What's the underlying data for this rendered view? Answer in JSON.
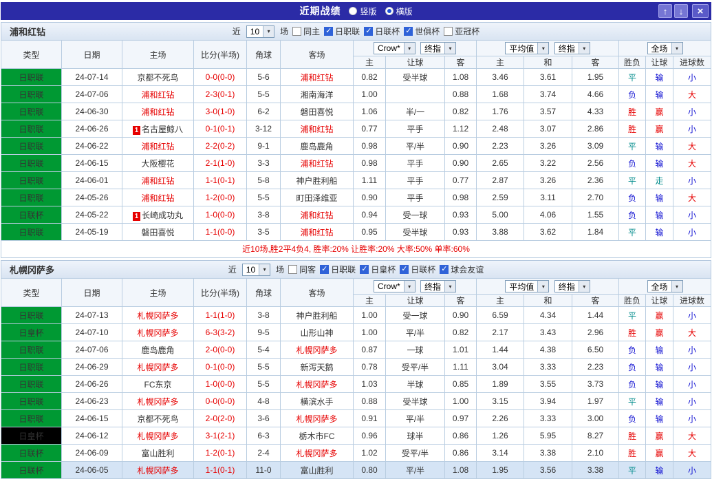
{
  "titlebar": {
    "title": "近期战绩",
    "options": [
      {
        "label": "竖版",
        "selected": false
      },
      {
        "label": "横版",
        "selected": true
      }
    ],
    "up_icon": "↑",
    "down_icon": "↓",
    "close_icon": "×"
  },
  "colors": {
    "accent_bar": "#2b2ba6",
    "league_green": "#009933",
    "league_black": "#000000",
    "focus_team": "#e60000",
    "score": "#e60000",
    "win": "#e60000",
    "draw": "#008b8b",
    "lose": "#1414d2",
    "cover": "#e60000",
    "not_cover": "#1414d2",
    "push": "#008b8b",
    "over": "#e60000",
    "under": "#1414d2",
    "row_highlight": "#d5e4f5"
  },
  "maps": {
    "result": {
      "胜": "win",
      "平": "draw",
      "负": "lose"
    },
    "handicap": {
      "赢": "cover",
      "输": "not_cover",
      "走": "push"
    },
    "goals": {
      "大": "over",
      "小": "under"
    }
  },
  "sections": [
    {
      "team": "浦和红钻",
      "filter": {
        "near": "近",
        "count": "10",
        "unit": "场",
        "checkboxes": [
          {
            "label": "同主",
            "checked": false
          },
          {
            "label": "日职联",
            "checked": true
          },
          {
            "label": "日联杯",
            "checked": true
          },
          {
            "label": "世俱杯",
            "checked": true
          },
          {
            "label": "亚冠杯",
            "checked": false
          }
        ]
      },
      "header": {
        "cols": [
          "类型",
          "日期",
          "主场",
          "比分(半场)",
          "角球",
          "客场"
        ],
        "bookmaker": "Crow*",
        "stage1": "终指",
        "avg": "平均值",
        "stage2": "终指",
        "fulltime": "全场",
        "sub": [
          "主",
          "让球",
          "客",
          "主",
          "和",
          "客",
          "胜负",
          "让球",
          "进球数"
        ]
      },
      "rows": [
        {
          "league": "日职联",
          "league_color": "league_green",
          "date": "24-07-14",
          "home": "京都不死鸟",
          "home_focus": false,
          "home_badge": "",
          "score": "0-0(0-0)",
          "corner": "5-6",
          "away": "浦和红钻",
          "away_focus": true,
          "odds": [
            "0.82",
            "受半球",
            "1.08"
          ],
          "avg": [
            "3.46",
            "3.61",
            "1.95"
          ],
          "result": "平",
          "handicap": "输",
          "goals": "小"
        },
        {
          "league": "日职联",
          "league_color": "league_green",
          "date": "24-07-06",
          "home": "浦和红钻",
          "home_focus": true,
          "home_badge": "",
          "score": "2-3(0-1)",
          "corner": "5-5",
          "away": "湘南海洋",
          "away_focus": false,
          "odds": [
            "1.00",
            "",
            "0.88"
          ],
          "avg": [
            "1.68",
            "3.74",
            "4.66"
          ],
          "result": "负",
          "handicap": "输",
          "goals": "大"
        },
        {
          "league": "日职联",
          "league_color": "league_green",
          "date": "24-06-30",
          "home": "浦和红钻",
          "home_focus": true,
          "home_badge": "",
          "score": "3-0(1-0)",
          "corner": "6-2",
          "away": "磐田喜悦",
          "away_focus": false,
          "odds": [
            "1.06",
            "半/一",
            "0.82"
          ],
          "avg": [
            "1.76",
            "3.57",
            "4.33"
          ],
          "result": "胜",
          "handicap": "赢",
          "goals": "小"
        },
        {
          "league": "日职联",
          "league_color": "league_green",
          "date": "24-06-26",
          "home": "名古屋鲸八",
          "home_focus": false,
          "home_badge": "1",
          "score": "0-1(0-1)",
          "corner": "3-12",
          "away": "浦和红钻",
          "away_focus": true,
          "odds": [
            "0.77",
            "平手",
            "1.12"
          ],
          "avg": [
            "2.48",
            "3.07",
            "2.86"
          ],
          "result": "胜",
          "handicap": "赢",
          "goals": "小"
        },
        {
          "league": "日职联",
          "league_color": "league_green",
          "date": "24-06-22",
          "home": "浦和红钻",
          "home_focus": true,
          "home_badge": "",
          "score": "2-2(0-2)",
          "corner": "9-1",
          "away": "鹿岛鹿角",
          "away_focus": false,
          "odds": [
            "0.98",
            "平/半",
            "0.90"
          ],
          "avg": [
            "2.23",
            "3.26",
            "3.09"
          ],
          "result": "平",
          "handicap": "输",
          "goals": "大"
        },
        {
          "league": "日职联",
          "league_color": "league_green",
          "date": "24-06-15",
          "home": "大阪樱花",
          "home_focus": false,
          "home_badge": "",
          "score": "2-1(1-0)",
          "corner": "3-3",
          "away": "浦和红钻",
          "away_focus": true,
          "odds": [
            "0.98",
            "平手",
            "0.90"
          ],
          "avg": [
            "2.65",
            "3.22",
            "2.56"
          ],
          "result": "负",
          "handicap": "输",
          "goals": "大"
        },
        {
          "league": "日职联",
          "league_color": "league_green",
          "date": "24-06-01",
          "home": "浦和红钻",
          "home_focus": true,
          "home_badge": "",
          "score": "1-1(0-1)",
          "corner": "5-8",
          "away": "神户胜利船",
          "away_focus": false,
          "odds": [
            "1.11",
            "平手",
            "0.77"
          ],
          "avg": [
            "2.87",
            "3.26",
            "2.36"
          ],
          "result": "平",
          "handicap": "走",
          "goals": "小"
        },
        {
          "league": "日职联",
          "league_color": "league_green",
          "date": "24-05-26",
          "home": "浦和红钻",
          "home_focus": true,
          "home_badge": "",
          "score": "1-2(0-0)",
          "corner": "5-5",
          "away": "町田泽维亚",
          "away_focus": false,
          "odds": [
            "0.90",
            "平手",
            "0.98"
          ],
          "avg": [
            "2.59",
            "3.11",
            "2.70"
          ],
          "result": "负",
          "handicap": "输",
          "goals": "大"
        },
        {
          "league": "日联杯",
          "league_color": "league_green",
          "date": "24-05-22",
          "home": "长崎成功丸",
          "home_focus": false,
          "home_badge": "1",
          "score": "1-0(0-0)",
          "corner": "3-8",
          "away": "浦和红钻",
          "away_focus": true,
          "odds": [
            "0.94",
            "受一球",
            "0.93"
          ],
          "avg": [
            "5.00",
            "4.06",
            "1.55"
          ],
          "result": "负",
          "handicap": "输",
          "goals": "小"
        },
        {
          "league": "日职联",
          "league_color": "league_green",
          "date": "24-05-19",
          "home": "磐田喜悦",
          "home_focus": false,
          "home_badge": "",
          "score": "1-1(0-0)",
          "corner": "3-5",
          "away": "浦和红钻",
          "away_focus": true,
          "odds": [
            "0.95",
            "受半球",
            "0.93"
          ],
          "avg": [
            "3.88",
            "3.62",
            "1.84"
          ],
          "result": "平",
          "handicap": "输",
          "goals": "小"
        }
      ],
      "summary": "近10场,胜2平4负4, 胜率:20% 让胜率:20% 大率:50% 单率:60%"
    },
    {
      "team": "札幌冈萨多",
      "filter": {
        "near": "近",
        "count": "10",
        "unit": "场",
        "checkboxes": [
          {
            "label": "同客",
            "checked": false
          },
          {
            "label": "日职联",
            "checked": true
          },
          {
            "label": "日皇杯",
            "checked": true
          },
          {
            "label": "日联杯",
            "checked": true
          },
          {
            "label": "球会友谊",
            "checked": true
          }
        ]
      },
      "header": {
        "cols": [
          "类型",
          "日期",
          "主场",
          "比分(半场)",
          "角球",
          "客场"
        ],
        "bookmaker": "Crow*",
        "stage1": "终指",
        "avg": "平均值",
        "stage2": "终指",
        "fulltime": "全场",
        "sub": [
          "主",
          "让球",
          "客",
          "主",
          "和",
          "客",
          "胜负",
          "让球",
          "进球数"
        ]
      },
      "rows": [
        {
          "league": "日职联",
          "league_color": "league_green",
          "date": "24-07-13",
          "home": "札幌冈萨多",
          "home_focus": true,
          "home_badge": "",
          "score": "1-1(1-0)",
          "corner": "3-8",
          "away": "神户胜利船",
          "away_focus": false,
          "odds": [
            "1.00",
            "受一球",
            "0.90"
          ],
          "avg": [
            "6.59",
            "4.34",
            "1.44"
          ],
          "result": "平",
          "handicap": "赢",
          "goals": "小"
        },
        {
          "league": "日皇杯",
          "league_color": "league_green",
          "date": "24-07-10",
          "home": "札幌冈萨多",
          "home_focus": true,
          "home_badge": "",
          "score": "6-3(3-2)",
          "corner": "9-5",
          "away": "山形山神",
          "away_focus": false,
          "odds": [
            "1.00",
            "平/半",
            "0.82"
          ],
          "avg": [
            "2.17",
            "3.43",
            "2.96"
          ],
          "result": "胜",
          "handicap": "赢",
          "goals": "大"
        },
        {
          "league": "日职联",
          "league_color": "league_green",
          "date": "24-07-06",
          "home": "鹿岛鹿角",
          "home_focus": false,
          "home_badge": "",
          "score": "2-0(0-0)",
          "corner": "5-4",
          "away": "札幌冈萨多",
          "away_focus": true,
          "odds": [
            "0.87",
            "一球",
            "1.01"
          ],
          "avg": [
            "1.44",
            "4.38",
            "6.50"
          ],
          "result": "负",
          "handicap": "输",
          "goals": "小"
        },
        {
          "league": "日职联",
          "league_color": "league_green",
          "date": "24-06-29",
          "home": "札幌冈萨多",
          "home_focus": true,
          "home_badge": "",
          "score": "0-1(0-0)",
          "corner": "5-5",
          "away": "新泻天鹅",
          "away_focus": false,
          "odds": [
            "0.78",
            "受平/半",
            "1.11"
          ],
          "avg": [
            "3.04",
            "3.33",
            "2.23"
          ],
          "result": "负",
          "handicap": "输",
          "goals": "小"
        },
        {
          "league": "日职联",
          "league_color": "league_green",
          "date": "24-06-26",
          "home": "FC东京",
          "home_focus": false,
          "home_badge": "",
          "score": "1-0(0-0)",
          "corner": "5-5",
          "away": "札幌冈萨多",
          "away_focus": true,
          "odds": [
            "1.03",
            "半球",
            "0.85"
          ],
          "avg": [
            "1.89",
            "3.55",
            "3.73"
          ],
          "result": "负",
          "handicap": "输",
          "goals": "小"
        },
        {
          "league": "日职联",
          "league_color": "league_green",
          "date": "24-06-23",
          "home": "札幌冈萨多",
          "home_focus": true,
          "home_badge": "",
          "score": "0-0(0-0)",
          "corner": "4-8",
          "away": "横滨水手",
          "away_focus": false,
          "odds": [
            "0.88",
            "受半球",
            "1.00"
          ],
          "avg": [
            "3.15",
            "3.94",
            "1.97"
          ],
          "result": "平",
          "handicap": "输",
          "goals": "小"
        },
        {
          "league": "日职联",
          "league_color": "league_green",
          "date": "24-06-15",
          "home": "京都不死鸟",
          "home_focus": false,
          "home_badge": "",
          "score": "2-0(2-0)",
          "corner": "3-6",
          "away": "札幌冈萨多",
          "away_focus": true,
          "odds": [
            "0.91",
            "平/半",
            "0.97"
          ],
          "avg": [
            "2.26",
            "3.33",
            "3.00"
          ],
          "result": "负",
          "handicap": "输",
          "goals": "小"
        },
        {
          "league": "日皇杯",
          "league_color": "league_black",
          "date": "24-06-12",
          "home": "札幌冈萨多",
          "home_focus": true,
          "home_badge": "",
          "score": "3-1(2-1)",
          "corner": "6-3",
          "away": "栃木市FC",
          "away_focus": false,
          "odds": [
            "0.96",
            "球半",
            "0.86"
          ],
          "avg": [
            "1.26",
            "5.95",
            "8.27"
          ],
          "result": "胜",
          "handicap": "赢",
          "goals": "大"
        },
        {
          "league": "日联杯",
          "league_color": "league_green",
          "date": "24-06-09",
          "home": "富山胜利",
          "home_focus": false,
          "home_badge": "",
          "score": "1-2(0-1)",
          "corner": "2-4",
          "away": "札幌冈萨多",
          "away_focus": true,
          "odds": [
            "1.02",
            "受平/半",
            "0.86"
          ],
          "avg": [
            "3.14",
            "3.38",
            "2.10"
          ],
          "result": "胜",
          "handicap": "赢",
          "goals": "大"
        },
        {
          "league": "日联杯",
          "league_color": "league_green",
          "date": "24-06-05",
          "home": "札幌冈萨多",
          "home_focus": true,
          "home_badge": "",
          "score": "1-1(0-1)",
          "corner": "11-0",
          "away": "富山胜利",
          "away_focus": false,
          "odds": [
            "0.80",
            "平/半",
            "1.08"
          ],
          "avg": [
            "1.95",
            "3.56",
            "3.38"
          ],
          "result": "平",
          "handicap": "输",
          "goals": "小",
          "highlight": true
        }
      ],
      "summary": ""
    }
  ]
}
